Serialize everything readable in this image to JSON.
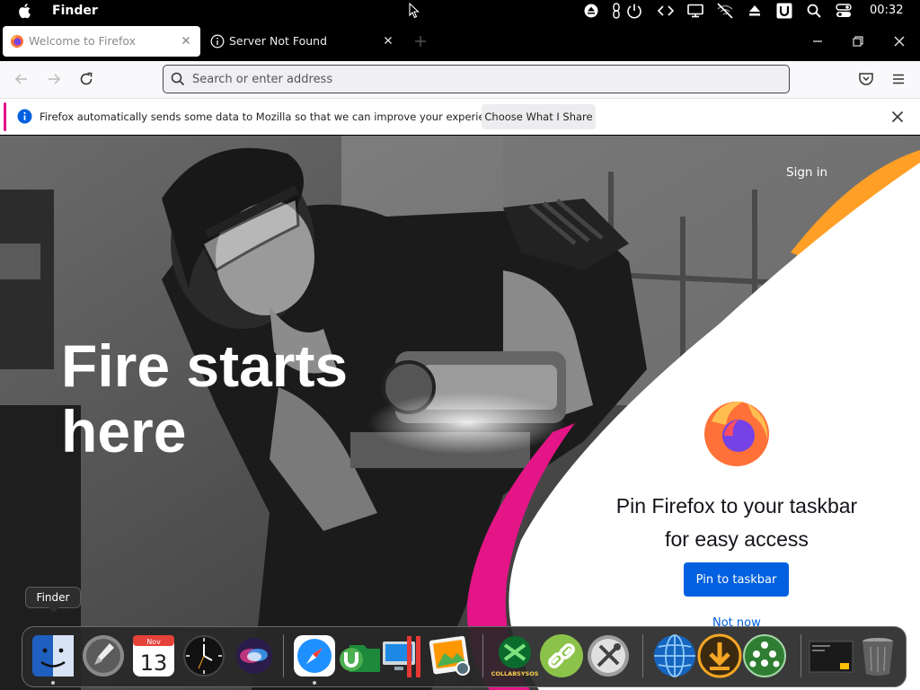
{
  "menubar": {
    "app_name": "Finder",
    "clock": "00:32"
  },
  "tabs": [
    {
      "label": "Welcome to Firefox",
      "active": true
    },
    {
      "label": "Server Not Found",
      "active": false
    }
  ],
  "urlbar": {
    "placeholder": "Search or enter address"
  },
  "notification": {
    "message": "Firefox automatically sends some data to Mozilla so that we can improve your experience.",
    "button_label": "Choose What I Share"
  },
  "hero": {
    "headline_line1": "Fire starts",
    "headline_line2": "here",
    "sign_in": "Sign in",
    "pin_title_line1": "Pin Firefox to your taskbar",
    "pin_title_line2": "for easy access",
    "pin_button": "Pin to taskbar",
    "not_now": "Not now"
  },
  "dock": {
    "tooltip": "Finder",
    "calendar_month": "Nov",
    "calendar_day": "13",
    "collabs_label": "COLLABSYSOS"
  },
  "colors": {
    "firefox_blue": "#0060df",
    "notification_accent": "#e31587",
    "hero_orange": "#ff9f26",
    "hero_pink": "#e31587"
  }
}
